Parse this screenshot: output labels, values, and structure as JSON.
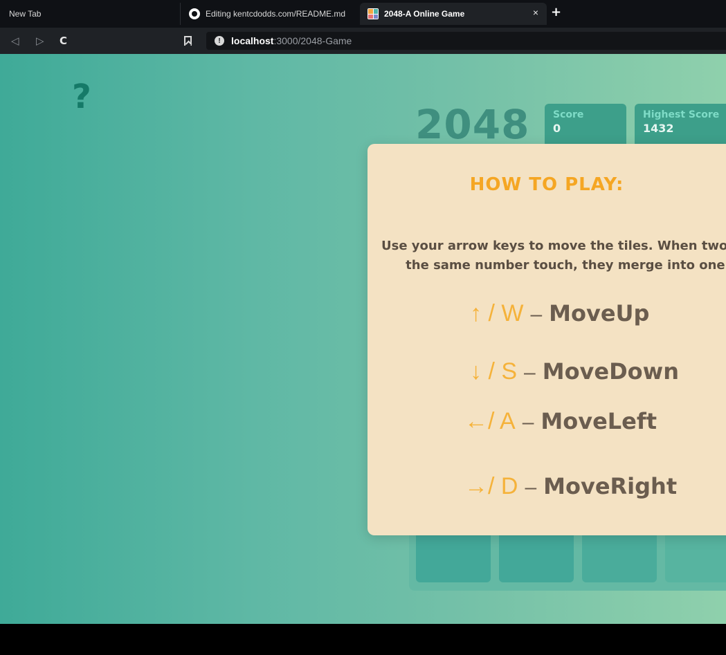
{
  "browser": {
    "tabs": [
      {
        "title": "New Tab"
      },
      {
        "title": "Editing kentcdodds.com/README.md"
      },
      {
        "title": "2048-A Online Game",
        "active": true
      }
    ],
    "close_glyph": "×",
    "new_tab_glyph": "+",
    "nav": {
      "back": "◁",
      "forward": "▷",
      "reload": "C"
    },
    "url": {
      "host": "localhost",
      "path": ":3000/2048-Game",
      "info_glyph": "!"
    }
  },
  "page": {
    "help_glyph": "?",
    "title": "2048",
    "scores": [
      {
        "label": "Score",
        "value": "0"
      },
      {
        "label": "Highest Score",
        "value": "1432"
      }
    ]
  },
  "modal": {
    "title": "HOW TO PLAY:",
    "description_line1": "Use your arrow keys to move the tiles. When two tiles",
    "description_line2": "the same number touch, they merge into one!",
    "controls": [
      {
        "keys": "↑ / W",
        "dash": "–",
        "action": "MoveUp"
      },
      {
        "keys": "↓ / S",
        "dash": "–",
        "action": "MoveDown"
      },
      {
        "keys": "←/ A",
        "dash": "–",
        "action": "MoveLeft"
      },
      {
        "keys": "→/ D",
        "dash": "–",
        "action": "MoveRight"
      }
    ]
  },
  "colors": {
    "accent": "#f5a623",
    "modal_bg": "#f4e2c3",
    "page_green": "#5fb8a5",
    "help_icon": "#157a68"
  }
}
